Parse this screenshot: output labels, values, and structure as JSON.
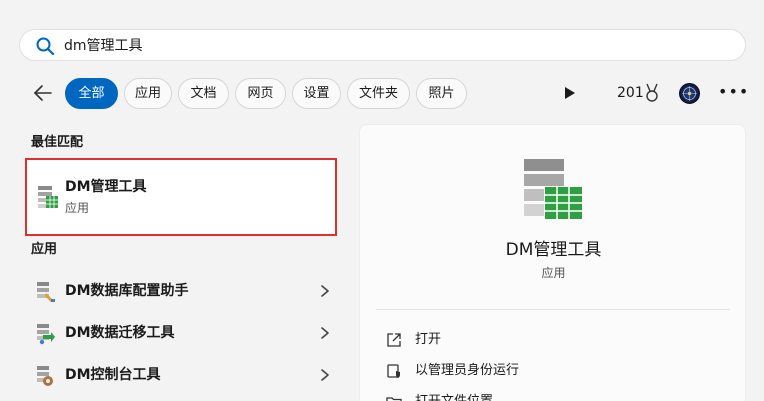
{
  "search": {
    "query": "dm管理工具"
  },
  "filters": {
    "tabs": [
      {
        "label": "全部",
        "active": true
      },
      {
        "label": "应用"
      },
      {
        "label": "文档"
      },
      {
        "label": "网页"
      },
      {
        "label": "设置"
      },
      {
        "label": "文件夹"
      },
      {
        "label": "照片"
      }
    ],
    "points": "201"
  },
  "best_match": {
    "heading": "最佳匹配",
    "title": "DM管理工具",
    "subtitle": "应用"
  },
  "apps": {
    "heading": "应用",
    "items": [
      {
        "label": "DM数据库配置助手"
      },
      {
        "label": "DM数据迁移工具"
      },
      {
        "label": "DM控制台工具"
      }
    ]
  },
  "detail": {
    "name": "DM管理工具",
    "type": "应用",
    "actions": [
      {
        "label": "打开"
      },
      {
        "label": "以管理员身份运行"
      },
      {
        "label": "打开文件位置"
      }
    ]
  },
  "colors": {
    "accent": "#0067c0",
    "highlight_border": "#e0302b",
    "app_icon_green": "#2ea043"
  }
}
